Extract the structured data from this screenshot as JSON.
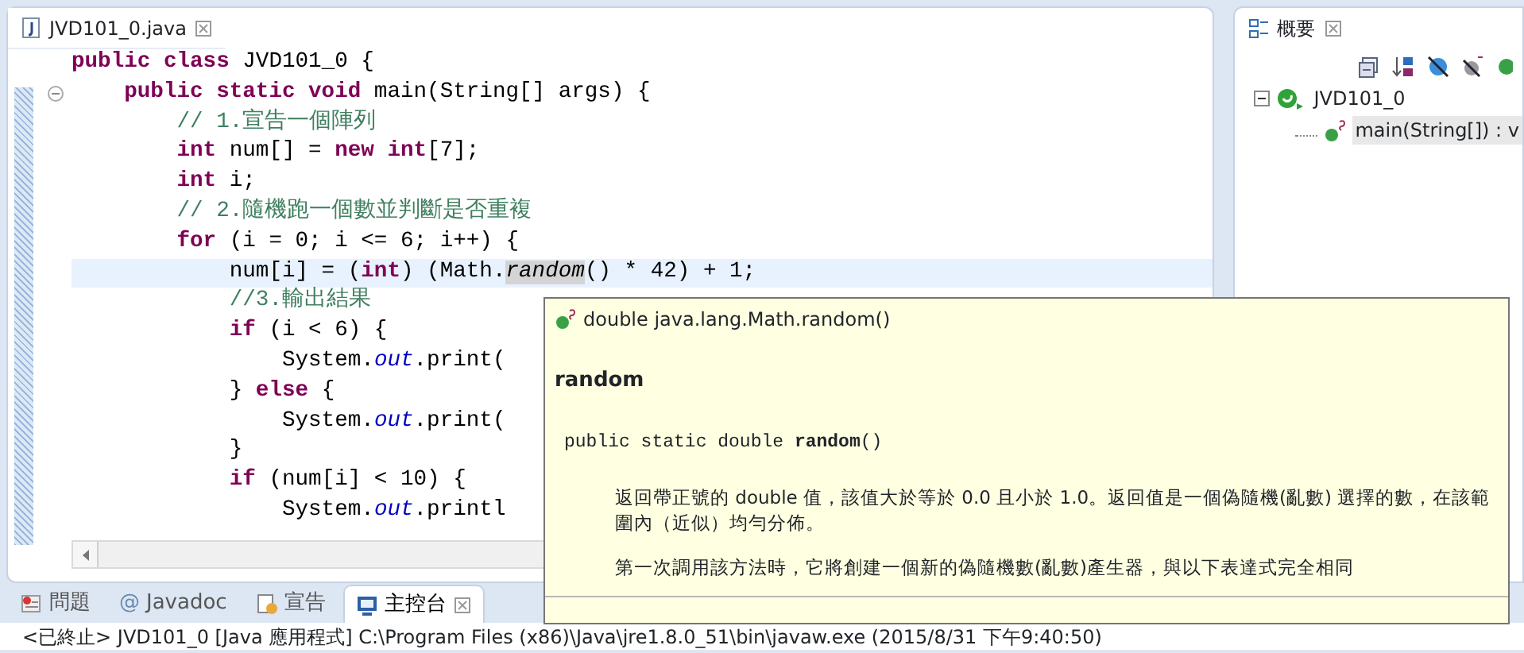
{
  "editor": {
    "tab": {
      "title": "JVD101_0.java",
      "selected": true
    },
    "lines": [
      {
        "current": false,
        "fold": false,
        "segments": [
          {
            "kind": "kw",
            "text": "public class"
          },
          {
            "kind": "plain",
            "text": " JVD101_0 {"
          }
        ]
      },
      {
        "current": false,
        "fold": true,
        "segments": [
          {
            "kind": "kw",
            "text": "    public static void"
          },
          {
            "kind": "plain",
            "text": " main(String[] args) {"
          }
        ]
      },
      {
        "current": false,
        "fold": false,
        "segments": [
          {
            "kind": "comment",
            "text": "        // 1.宣告一個陣列"
          }
        ]
      },
      {
        "current": false,
        "fold": false,
        "segments": [
          {
            "kind": "kw",
            "text": "        int"
          },
          {
            "kind": "plain",
            "text": " num[] = "
          },
          {
            "kind": "kw",
            "text": "new int"
          },
          {
            "kind": "plain",
            "text": "[7];"
          }
        ]
      },
      {
        "current": false,
        "fold": false,
        "segments": [
          {
            "kind": "kw",
            "text": "        int"
          },
          {
            "kind": "plain",
            "text": " i;"
          }
        ]
      },
      {
        "current": false,
        "fold": false,
        "segments": [
          {
            "kind": "comment",
            "text": "        // 2.隨機跑一個數並判斷是否重複"
          }
        ]
      },
      {
        "current": false,
        "fold": false,
        "segments": [
          {
            "kind": "kw",
            "text": "        for"
          },
          {
            "kind": "plain",
            "text": " (i = 0; i <= 6; i++) {"
          }
        ]
      },
      {
        "current": true,
        "fold": false,
        "segments": [
          {
            "kind": "plain",
            "text": "            num[i] = ("
          },
          {
            "kind": "kw",
            "text": "int"
          },
          {
            "kind": "plain",
            "text": ") (Math."
          },
          {
            "kind": "hover",
            "text": "random"
          },
          {
            "kind": "plain",
            "text": "() * 42) + 1;"
          }
        ]
      },
      {
        "current": false,
        "fold": false,
        "segments": [
          {
            "kind": "comment",
            "text": "            //3.輸出結果"
          }
        ]
      },
      {
        "current": false,
        "fold": false,
        "segments": [
          {
            "kind": "kw",
            "text": "            if"
          },
          {
            "kind": "plain",
            "text": " (i < 6) {"
          }
        ]
      },
      {
        "current": false,
        "fold": false,
        "segments": [
          {
            "kind": "plain",
            "text": "                System."
          },
          {
            "kind": "field",
            "text": "out"
          },
          {
            "kind": "plain",
            "text": ".print("
          }
        ]
      },
      {
        "current": false,
        "fold": false,
        "segments": [
          {
            "kind": "plain",
            "text": "            } "
          },
          {
            "kind": "kw",
            "text": "else"
          },
          {
            "kind": "plain",
            "text": " {"
          }
        ]
      },
      {
        "current": false,
        "fold": false,
        "segments": [
          {
            "kind": "plain",
            "text": "                System."
          },
          {
            "kind": "field",
            "text": "out"
          },
          {
            "kind": "plain",
            "text": ".print("
          }
        ]
      },
      {
        "current": false,
        "fold": false,
        "segments": [
          {
            "kind": "plain",
            "text": "            }"
          }
        ]
      },
      {
        "current": false,
        "fold": false,
        "segments": [
          {
            "kind": "kw",
            "text": "            if"
          },
          {
            "kind": "plain",
            "text": " (num[i] < 10) {"
          }
        ]
      },
      {
        "current": false,
        "fold": false,
        "segments": [
          {
            "kind": "plain",
            "text": "                System."
          },
          {
            "kind": "field",
            "text": "out"
          },
          {
            "kind": "plain",
            "text": ".printl"
          }
        ]
      }
    ]
  },
  "tooltip": {
    "header": "double java.lang.Math.random()",
    "title": "random",
    "signature": "public static double **random**()",
    "paragraphs": [
      "返回帶正號的 double 值，該值大於等於 0.0 且小於 1.0。返回值是一個偽隨機(亂數) 選擇的數，在該範圍內（近似）均勻分佈。",
      "第一次調用該方法時，它將創建一個新的偽隨機數(亂數)產生器，與以下表達式完全相同"
    ]
  },
  "outline": {
    "title": "概要",
    "tree": [
      {
        "label": "JVD101_0",
        "kind": "class",
        "expanded": true,
        "selected": false,
        "children": [
          {
            "label": "main(String[]) : v",
            "kind": "method",
            "selected": true
          }
        ]
      }
    ]
  },
  "bottom_tabs": [
    {
      "label": "問題",
      "kind": "problems",
      "selected": false
    },
    {
      "label": "Javadoc",
      "kind": "javadoc",
      "glyph": "@",
      "selected": false
    },
    {
      "label": "宣告",
      "kind": "declaration",
      "selected": false
    },
    {
      "label": "主控台",
      "kind": "console",
      "selected": true
    }
  ],
  "console_line": "<已終止> JVD101_0 [Java 應用程式] C:\\Program Files (x86)\\Java\\jre1.8.0_51\\bin\\javaw.exe (2015/8/31 下午9:40:50)"
}
